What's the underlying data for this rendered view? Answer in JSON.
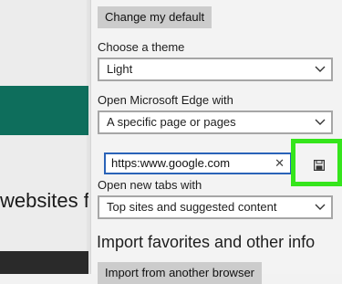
{
  "page": {
    "text": "websites f"
  },
  "settings": {
    "change_default_button": "Change my default",
    "theme": {
      "label": "Choose a theme",
      "value": "Light"
    },
    "open_with": {
      "label": "Open Microsoft Edge with",
      "value": "A specific page or pages"
    },
    "url_input": {
      "value": "https:www.google.com",
      "clear_icon": "close-icon",
      "save_icon": "save-icon"
    },
    "new_tabs": {
      "label": "Open new tabs with",
      "value": "Top sites and suggested content"
    },
    "import_section": {
      "title": "Import favorites and other info",
      "button": "Import from another browser"
    }
  },
  "colors": {
    "highlight": "#35e51c",
    "input_focus": "#2a63b8",
    "page_band": "#0e6e5c"
  }
}
